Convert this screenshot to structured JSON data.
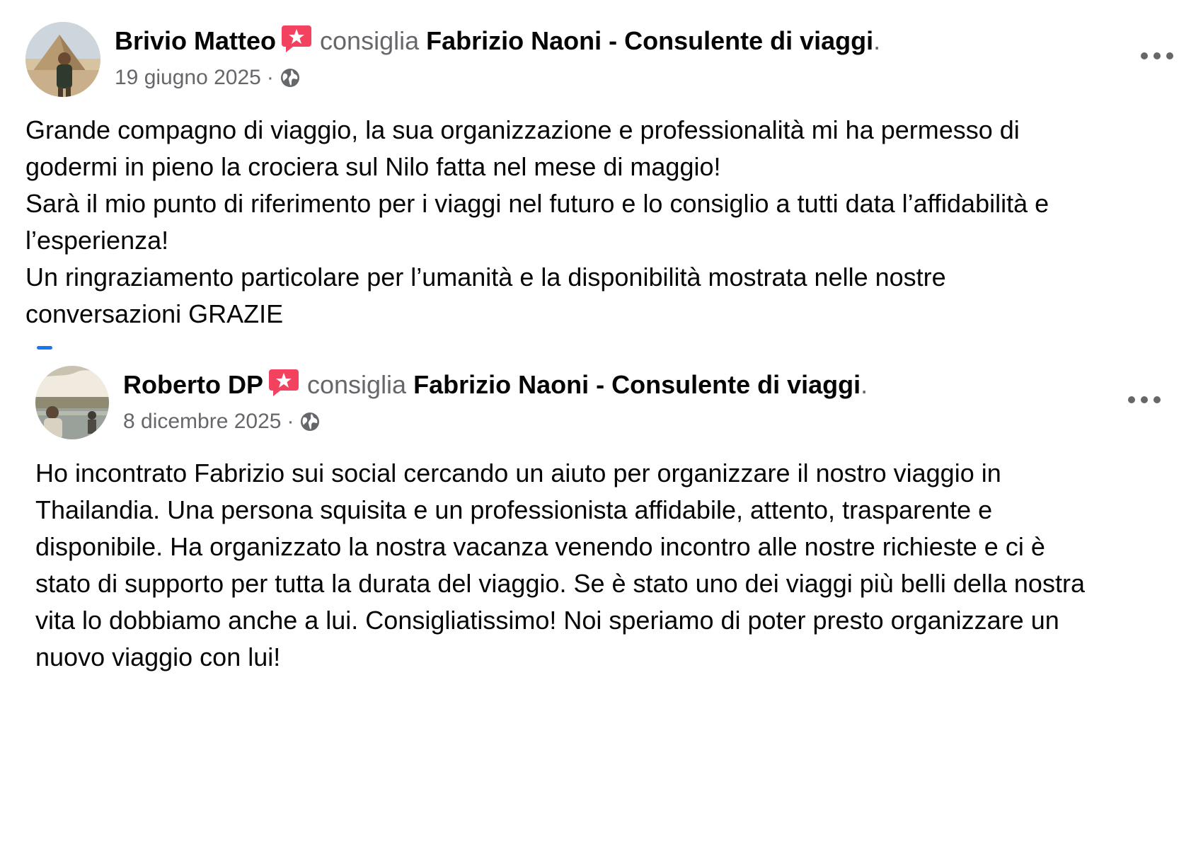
{
  "posts": [
    {
      "author": "Brivio Matteo",
      "verb": "consiglia",
      "page": "Fabrizio Naoni - Consulente di viaggi",
      "end_dot": ".",
      "date": "19 giugno 2025",
      "separator": "·",
      "privacy_icon": "globe-icon",
      "badge_icon": "recommend-star-icon",
      "more_icon": "more-options-icon",
      "text": "Grande compagno di viaggio, la sua organizzazione e professionalità mi ha permesso di\ngodermi in pieno la crociera sul Nilo fatta nel mese di maggio!\nSarà il mio punto di riferimento per i viaggi nel futuro e lo consiglio a tutti data l’affidabilità e\nl’esperienza!\nUn ringraziamento particolare per l’umanità e la disponibilità mostrata nelle nostre\nconversazioni GRAZIE"
    },
    {
      "author": "Roberto DP",
      "verb": "consiglia",
      "page": "Fabrizio Naoni - Consulente di viaggi",
      "end_dot": ".",
      "date": "8 dicembre 2025",
      "separator": "·",
      "privacy_icon": "globe-icon",
      "badge_icon": "recommend-star-icon",
      "more_icon": "more-options-icon",
      "text": "Ho incontrato Fabrizio sui social cercando un aiuto per organizzare il nostro viaggio in\nThailandia. Una persona squisita e un professionista affidabile, attento, trasparente e\ndisponibile. Ha organizzato la nostra vacanza venendo incontro alle nostre richieste e ci è\nstato di supporto per tutta la durata del viaggio. Se è stato uno dei viaggi più belli della nostra\nvita lo dobbiamo anche a lui. Consigliatissimo! Noi speriamo di poter presto organizzare un\nnuovo viaggio con lui!"
    }
  ],
  "colors": {
    "text_primary": "#050505",
    "text_secondary": "#65676b",
    "badge": "#f3425f",
    "accent": "#1877f2"
  }
}
